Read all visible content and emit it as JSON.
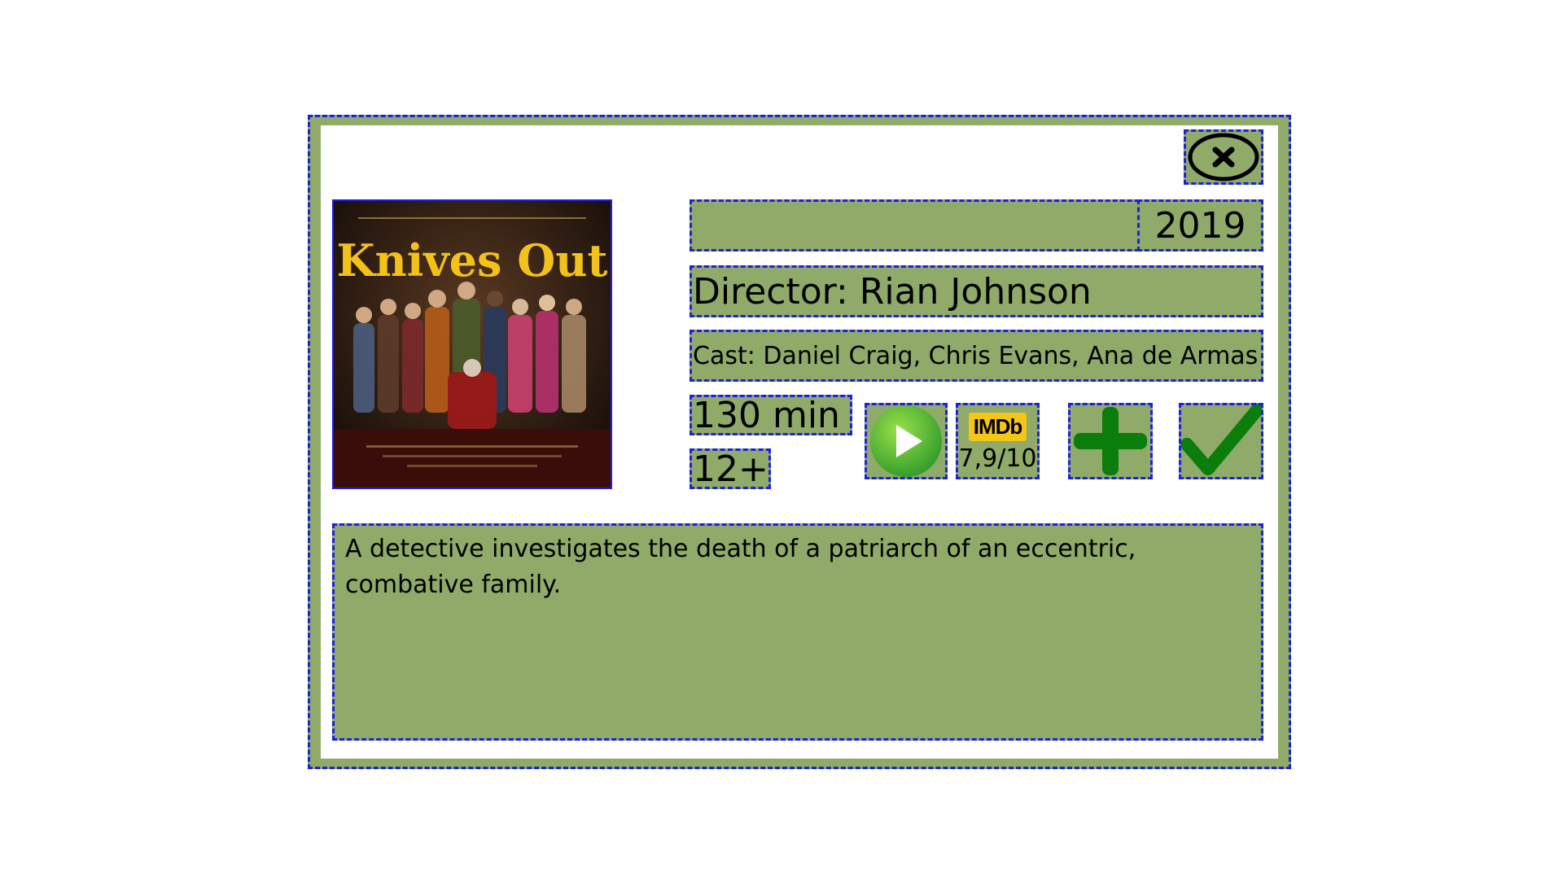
{
  "movie": {
    "year": "2019",
    "director": "Director: Rian Johnson",
    "cast": "Cast: Daniel Craig, Chris Evans, Ana de Armas",
    "runtime": "130 min",
    "age_rating": "12+",
    "imdb_logo": "IMDb",
    "imdb_rating": "7,9/10",
    "description": "A detective investigates the death of a patriarch of an eccentric, combative family."
  },
  "poster": {
    "title": "Knives Out",
    "title_color": "#f2c11a"
  },
  "icons": {
    "close": "close-circle-icon",
    "play": "play-icon",
    "add": "plus-icon",
    "watched": "checkmark-icon"
  },
  "colors": {
    "panel": "#8faa69",
    "outline": "#1e1ee6",
    "action_green": "#0a7d0a"
  }
}
